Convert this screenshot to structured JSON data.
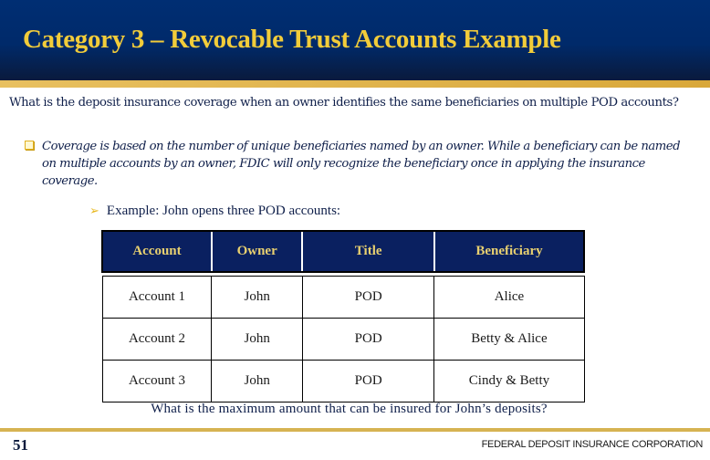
{
  "header": {
    "title": "Category 3 – Revocable Trust Accounts Example"
  },
  "question": "What is the deposit insurance coverage when an owner identifies the same beneficiaries on multiple POD accounts?",
  "bullet": {
    "icon": "square-bullet-icon",
    "text": "Coverage is based on the number of unique beneficiaries named by an owner.  While a beneficiary can be named on multiple accounts by an owner, FDIC will only recognize the beneficiary once in applying the insurance coverage."
  },
  "example": {
    "icon": "arrow-bullet-icon",
    "glyph": "➢",
    "text": "Example: John opens three POD accounts:"
  },
  "table": {
    "headers": [
      "Account",
      "Owner",
      "Title",
      "Beneficiary"
    ],
    "rows": [
      [
        "Account 1",
        "John",
        "POD",
        "Alice"
      ],
      [
        "Account 2",
        "John",
        "POD",
        "Betty & Alice"
      ],
      [
        "Account 3",
        "John",
        "POD",
        "Cindy & Betty"
      ]
    ]
  },
  "final_question": "What is the maximum amount that can be insured for John’s deposits?",
  "footer": {
    "page_number": "51",
    "organization": "FEDERAL DEPOSIT INSURANCE CORPORATION"
  },
  "colors": {
    "header_bg": "#002e73",
    "title_gold": "#f2cc3a",
    "accent_gold": "#d6b352",
    "table_header_bg": "#0a2060",
    "table_header_text": "#e8d070"
  }
}
